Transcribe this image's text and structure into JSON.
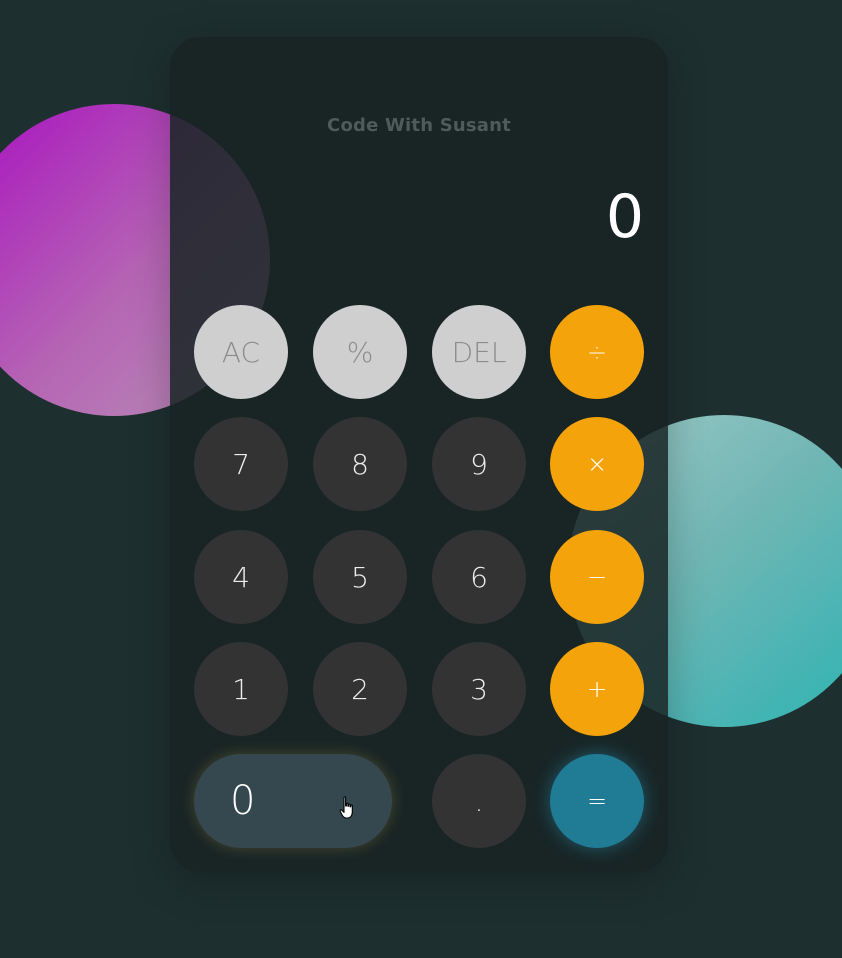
{
  "credit": "Code With Susant",
  "display": "0",
  "keys": {
    "ac": "AC",
    "percent": "%",
    "del": "DEL",
    "divide": "÷",
    "seven": "7",
    "eight": "8",
    "nine": "9",
    "multiply": "×",
    "four": "4",
    "five": "5",
    "six": "6",
    "minus": "−",
    "one": "1",
    "two": "2",
    "three": "3",
    "plus": "+",
    "zero": "0",
    "dot": ".",
    "equals": "="
  },
  "colors": {
    "background": "#1e2f2f",
    "panel": "#182424",
    "function_key": "#cfcfcf",
    "number_key": "#333333",
    "operator_key": "#f5a30a",
    "equals_key": "#1f7c94",
    "zero_key_hover": "#35474f",
    "blob_pink": "#a80fc0",
    "blob_teal": "#2bb3b3"
  },
  "icons": {
    "cursor": "hand-pointer-icon"
  }
}
